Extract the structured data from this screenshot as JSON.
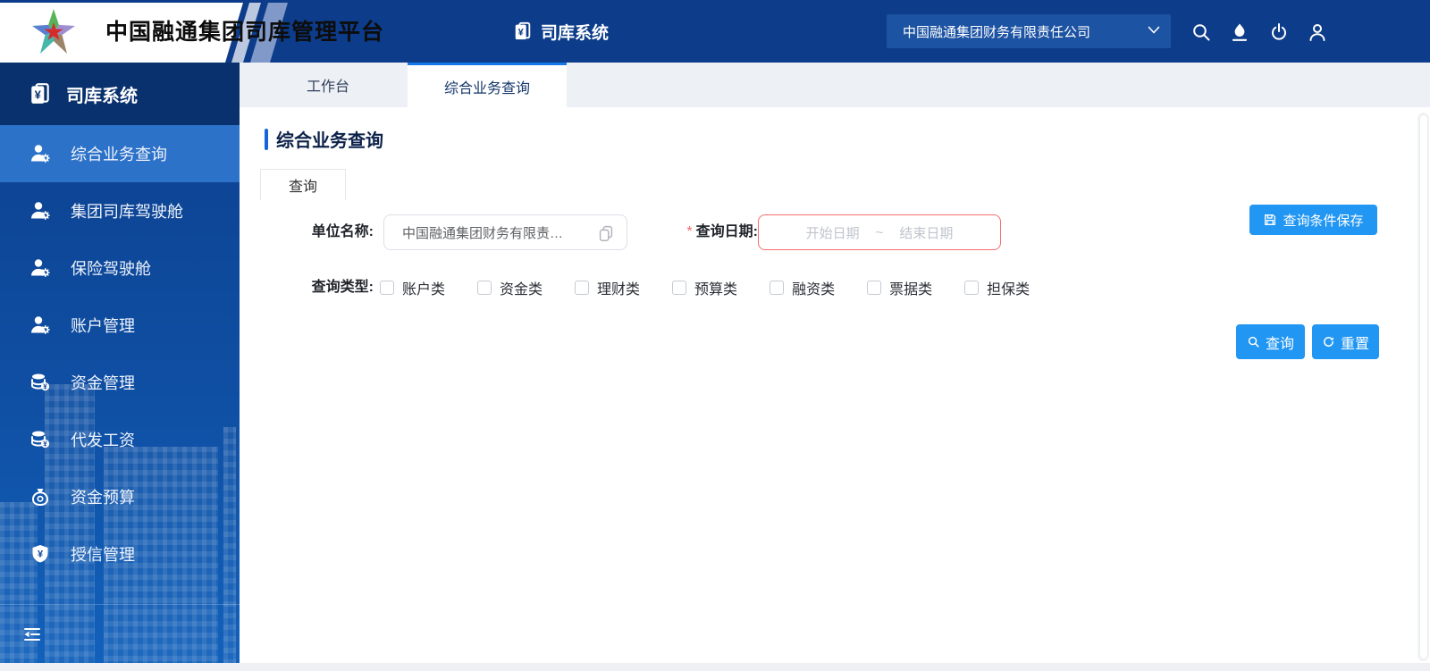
{
  "header": {
    "platform_title": "中国融通集团司库管理平台",
    "nav_item": "司库系统",
    "org_selector_value": "中国融通集团财务有限责任公司"
  },
  "sidebar": {
    "system_title": "司库系统",
    "items": [
      {
        "label": "综合业务查询",
        "icon": "user-gear-icon",
        "active": true
      },
      {
        "label": "集团司库驾驶舱",
        "icon": "user-gear-icon",
        "active": false
      },
      {
        "label": "保险驾驶舱",
        "icon": "user-gear-icon",
        "active": false
      },
      {
        "label": "账户管理",
        "icon": "user-gear-icon",
        "active": false
      },
      {
        "label": "资金管理",
        "icon": "coins-icon",
        "active": false
      },
      {
        "label": "代发工资",
        "icon": "coins-icon",
        "active": false
      },
      {
        "label": "资金预算",
        "icon": "moneybag-icon",
        "active": false
      },
      {
        "label": "授信管理",
        "icon": "shield-yuan-icon",
        "active": false
      }
    ]
  },
  "tabs": [
    {
      "label": "工作台",
      "active": false
    },
    {
      "label": "综合业务查询",
      "active": true
    }
  ],
  "main": {
    "page_title": "综合业务查询",
    "query_tab_label": "查询",
    "form": {
      "org_label": "单位名称:",
      "org_value": "中国融通集团财务有限责…",
      "required_mark": "*",
      "date_label": "查询日期:",
      "date_start_placeholder": "开始日期",
      "date_separator": "~",
      "date_end_placeholder": "结束日期",
      "type_label": "查询类型:",
      "type_options": [
        "账户类",
        "资金类",
        "理财类",
        "预算类",
        "融资类",
        "票据类",
        "担保类"
      ]
    },
    "buttons": {
      "save_condition": "查询条件保存",
      "search": "查询",
      "reset": "重置"
    }
  },
  "icons": {
    "app-logo-star": "five-color star with red star center",
    "passbook-yuan-icon": "booklet with yuan sign",
    "user-gear-icon": "person with gear",
    "coins-icon": "coin stack with yuan coin",
    "moneybag-icon": "money bag",
    "shield-yuan-icon": "shield with yuan sign",
    "search-icon": "magnifier",
    "theme-skin-icon": "ink drop with underline",
    "power-icon": "power switch",
    "user-icon": "person outline",
    "chevron-down-icon": "v chevron",
    "save-icon": "floppy disk",
    "refresh-icon": "circular arrow",
    "copy-icon": "two stacked squares",
    "collapse-icon": "fold menu arrow lines"
  },
  "colors": {
    "header_navy": "#0c3c8a",
    "header_select": "#1d53a3",
    "sidebar_top": "#0d3f8e",
    "sidebar_bottom": "#1261bb",
    "sidebar_header": "#09316e",
    "sidebar_active": "#2d72c9",
    "primary_blue": "#2196f3",
    "danger_red": "#f56c6c",
    "tabstrip_bg": "#edf0f5",
    "active_tab_accent": "#1877e8",
    "title_accent": "#1465d8"
  }
}
